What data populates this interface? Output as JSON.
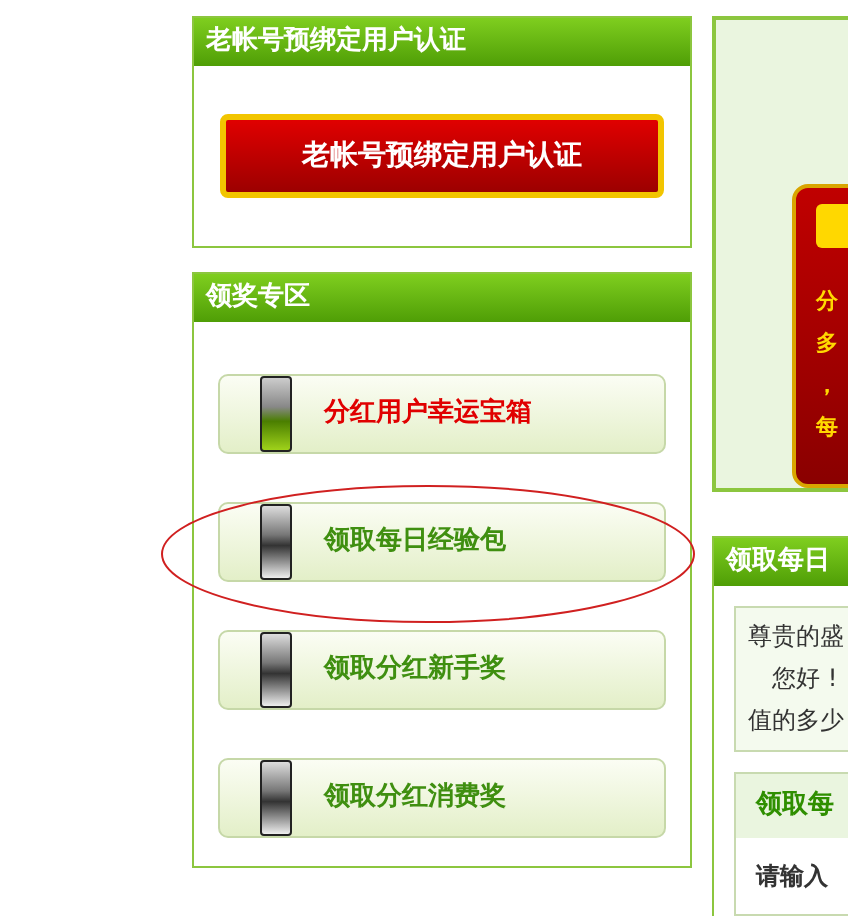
{
  "bind_panel": {
    "title": "老帐号预绑定用户认证",
    "button": "老帐号预绑定用户认证"
  },
  "prize_panel": {
    "title": "领奖专区",
    "items": [
      {
        "label": "分红用户幸运宝箱",
        "selected": true,
        "circled": false
      },
      {
        "label": "领取每日经验包",
        "selected": false,
        "circled": true
      },
      {
        "label": "领取分红新手奖",
        "selected": false,
        "circled": false
      },
      {
        "label": "领取分红消费奖",
        "selected": false,
        "circled": false
      }
    ]
  },
  "banner": {
    "lines": [
      "分",
      "多",
      "，",
      "每"
    ]
  },
  "daily_panel": {
    "title": "领取每日",
    "lines": [
      "尊贵的盛",
      "　您好 !",
      "值的多少"
    ],
    "sub_title": "领取每",
    "prompt": "请输入"
  }
}
